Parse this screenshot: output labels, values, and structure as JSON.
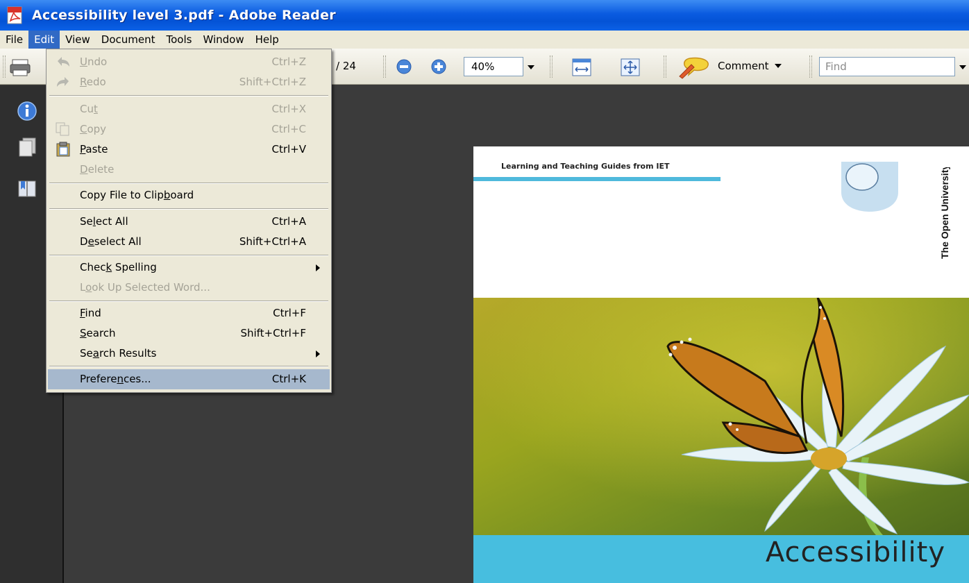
{
  "window": {
    "title": "Accessibility level 3.pdf - Adobe Reader"
  },
  "menubar": [
    {
      "label": "File"
    },
    {
      "label": "Edit"
    },
    {
      "label": "View"
    },
    {
      "label": "Document"
    },
    {
      "label": "Tools"
    },
    {
      "label": "Window"
    },
    {
      "label": "Help"
    }
  ],
  "toolbar": {
    "page_total": "/ 24",
    "zoom": "40%",
    "comment_label": "Comment",
    "find_placeholder": "Find"
  },
  "edit_menu": {
    "undo": {
      "pre": "",
      "key": "U",
      "post": "ndo",
      "shortcut": "Ctrl+Z"
    },
    "redo": {
      "pre": "",
      "key": "R",
      "post": "edo",
      "shortcut": "Shift+Ctrl+Z"
    },
    "cut": {
      "pre": "Cu",
      "key": "t",
      "post": "",
      "shortcut": "Ctrl+X"
    },
    "copy": {
      "pre": "",
      "key": "C",
      "post": "opy",
      "shortcut": "Ctrl+C"
    },
    "paste": {
      "pre": "",
      "key": "P",
      "post": "aste",
      "shortcut": "Ctrl+V"
    },
    "delete": {
      "pre": "",
      "key": "D",
      "post": "elete"
    },
    "copy_file": {
      "pre": "Copy File to Clip",
      "key": "b",
      "post": "oard"
    },
    "select_all": {
      "pre": "Se",
      "key": "l",
      "post": "ect All",
      "shortcut": "Ctrl+A"
    },
    "deselect_all": {
      "pre": "D",
      "key": "e",
      "post": "select All",
      "shortcut": "Shift+Ctrl+A"
    },
    "check_spelling": {
      "pre": "Chec",
      "key": "k",
      "post": " Spelling"
    },
    "look_up": {
      "pre": "L",
      "key": "o",
      "post": "ok Up Selected Word..."
    },
    "find": {
      "pre": "",
      "key": "F",
      "post": "ind",
      "shortcut": "Ctrl+F"
    },
    "search": {
      "pre": "",
      "key": "S",
      "post": "earch",
      "shortcut": "Shift+Ctrl+F"
    },
    "search_results": {
      "pre": "Se",
      "key": "a",
      "post": "rch Results"
    },
    "preferences": {
      "pre": "Prefere",
      "key": "n",
      "post": "ces...",
      "shortcut": "Ctrl+K"
    }
  },
  "document": {
    "guide_text": "Learning and Teaching Guides from IET",
    "university": "The Open University",
    "title": "Accessibility"
  },
  "colors": {
    "titlebar": "#0a5be0",
    "menu_highlight": "#316ac5",
    "dropdown_highlight": "#a6b8cd",
    "accent_bar": "#47bedf"
  }
}
